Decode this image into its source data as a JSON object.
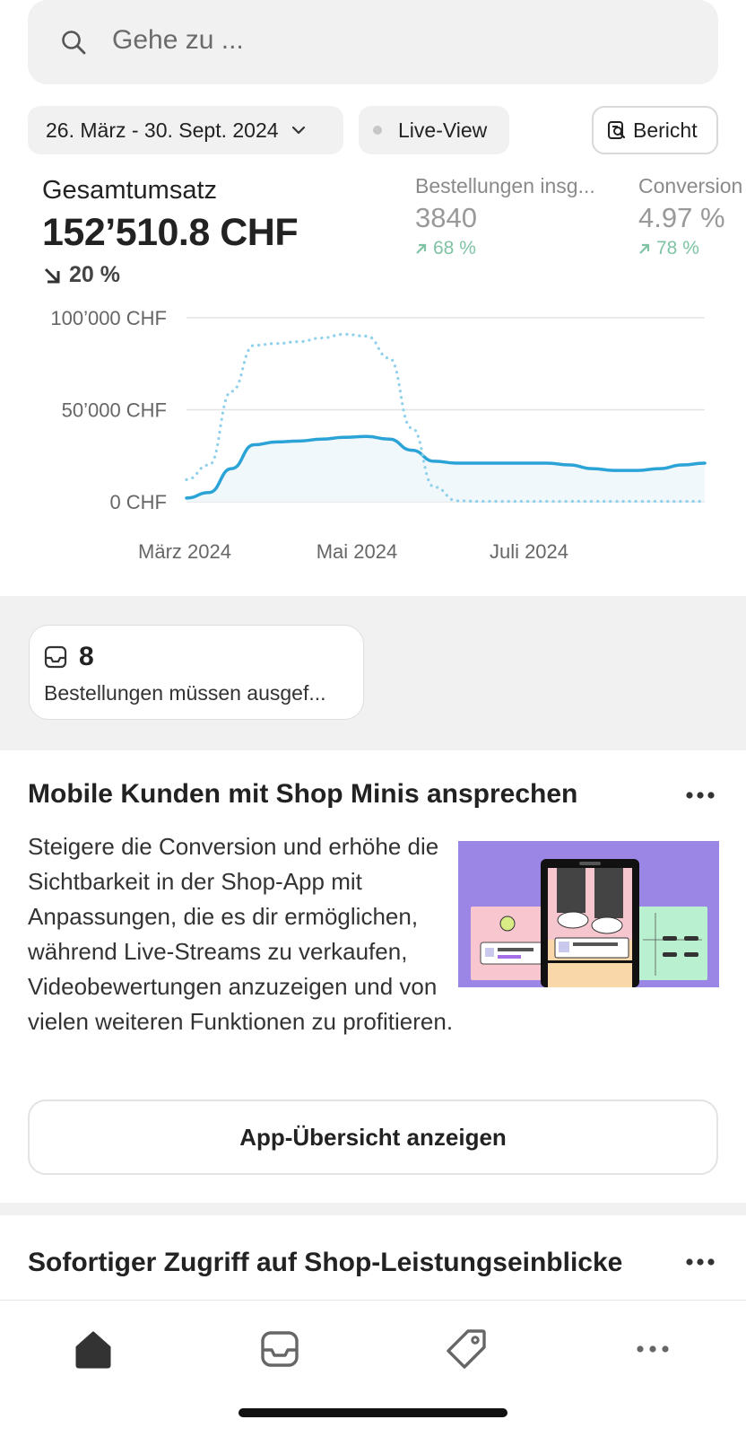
{
  "search": {
    "placeholder": "Gehe zu ..."
  },
  "filters": {
    "date_range": "26. März - 30. Sept. 2024",
    "live_view": "Live-View",
    "report": "Bericht"
  },
  "metrics": {
    "total_sales": {
      "label": "Gesamtumsatz",
      "value": "152’510.8 CHF",
      "change": "20 %",
      "direction": "down"
    },
    "orders": {
      "label": "Bestellungen insg...",
      "value": "3840",
      "change": "68 %",
      "direction": "up"
    },
    "conversion": {
      "label": "Conversion",
      "value": "4.97 %",
      "change": "78 %",
      "direction": "up"
    }
  },
  "chart_data": {
    "type": "line",
    "y_tick_labels": [
      "100’000 CHF",
      "50’000 CHF",
      "0 CHF"
    ],
    "x_tick_labels": [
      "März 2024",
      "Mai 2024",
      "Juli 2024"
    ],
    "ylim": [
      0,
      100000
    ],
    "grid": true,
    "series": [
      {
        "style": "solid",
        "color": "#2ba3d6",
        "values": [
          2000,
          5000,
          18000,
          31000,
          32500,
          33000,
          34000,
          35000,
          35500,
          34000,
          28000,
          22000,
          21000,
          21000,
          21000,
          21000,
          21000,
          20000,
          18000,
          17000,
          17000,
          18000,
          20000,
          21000
        ]
      },
      {
        "style": "dotted",
        "color": "#8fd0ea",
        "values": [
          12000,
          20000,
          60000,
          85000,
          86000,
          87000,
          89000,
          91000,
          90000,
          78000,
          40000,
          8000,
          500,
          200,
          200,
          200,
          200,
          200,
          200,
          200,
          200,
          200,
          200,
          200
        ]
      }
    ]
  },
  "orders_card": {
    "count": "8",
    "label": "Bestellungen müssen ausgef..."
  },
  "promo_card": {
    "title": "Mobile Kunden mit Shop Minis ansprechen",
    "body": "Steigere die Conversion und erhöhe die Sichtbarkeit in der Shop-App mit Anpassungen, die es dir ermöglichen, während Live-Streams zu verkaufen, Videobewertungen anzuzeigen und von vielen weiteren Funktionen zu profitieren.",
    "button": "App-Übersicht anzeigen"
  },
  "insights_card": {
    "title": "Sofortiger Zugriff auf Shop-Leistungseinblicke"
  },
  "colors": {
    "accent": "#2ba3d6",
    "positive": "#7fc3a3",
    "background_gray": "#f1f1f1"
  },
  "tabbar": {
    "items": [
      "home-icon",
      "inbox-icon",
      "tag-icon",
      "more-icon"
    ]
  }
}
